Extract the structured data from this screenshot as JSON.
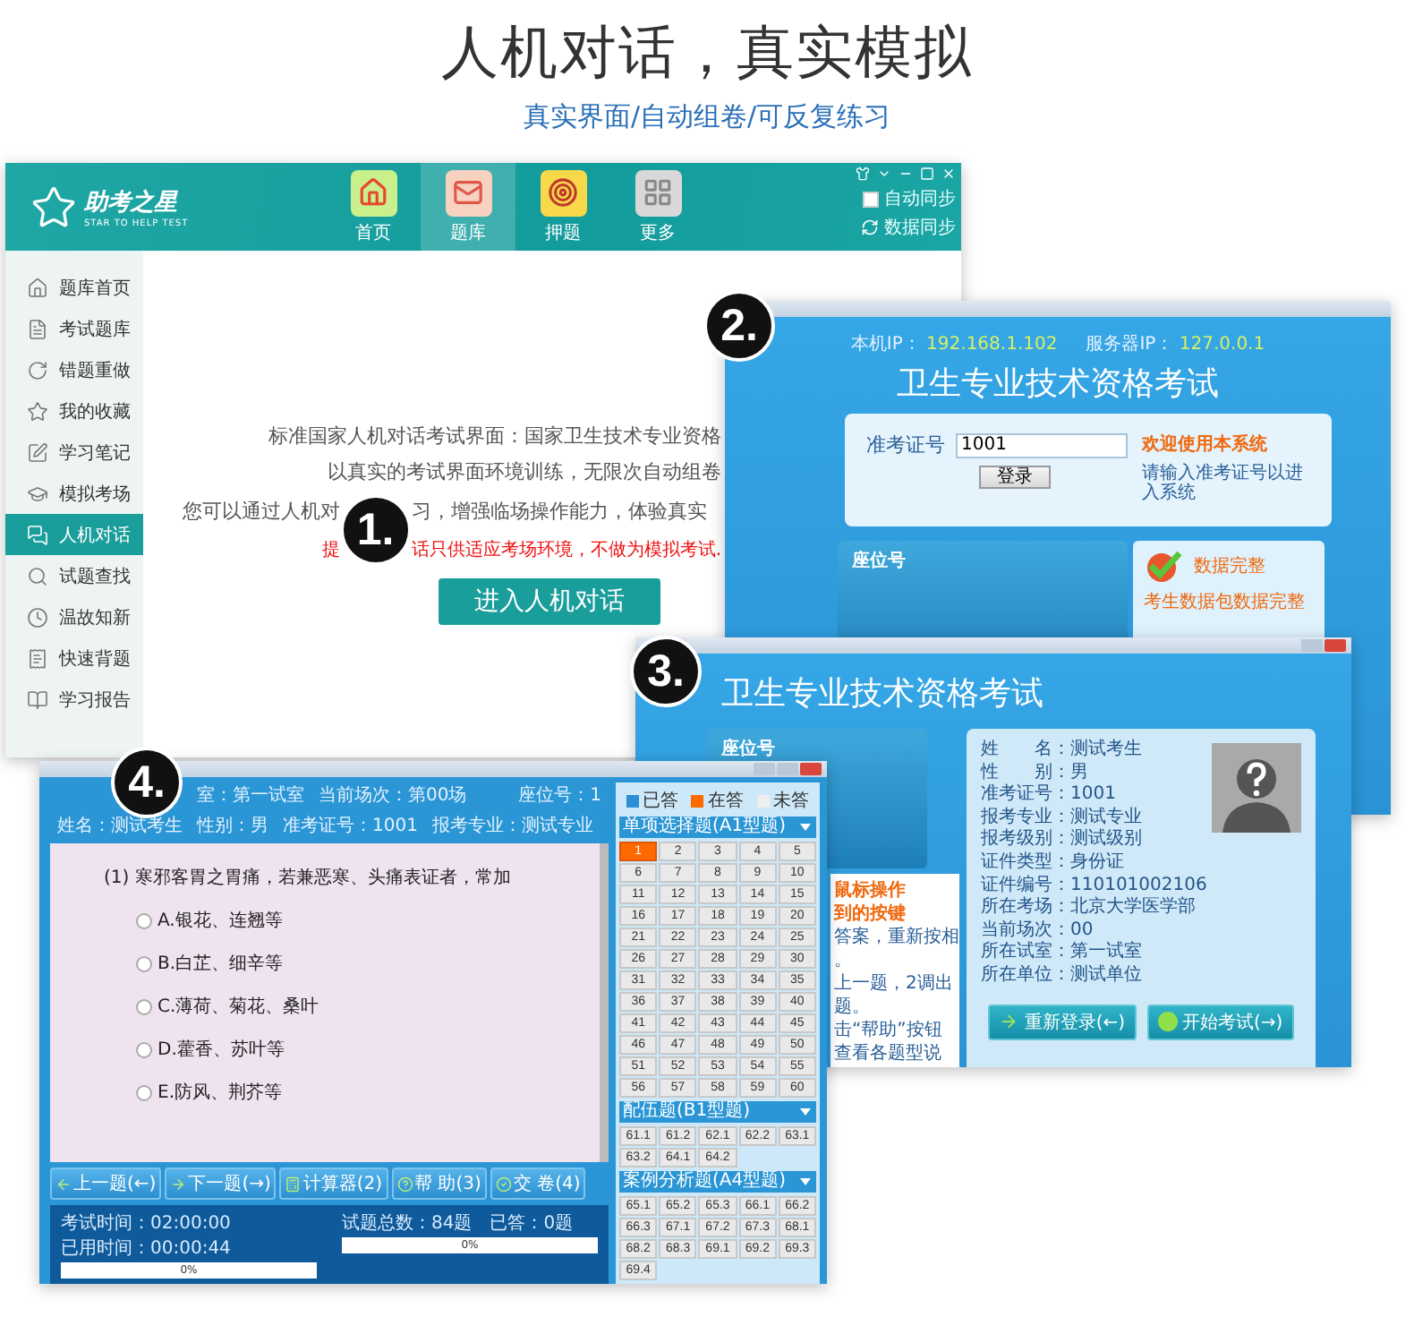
{
  "heading": {
    "title": "人机对话，真实模拟",
    "subtitle": "真实界面/自动组卷/可反复练习"
  },
  "badges": [
    "1.",
    "2.",
    "3.",
    "4."
  ],
  "main_window": {
    "logo": {
      "name": "助考之星",
      "tagline": "STAR TO HELP TEST"
    },
    "nav": [
      {
        "label": "首页",
        "selected": false
      },
      {
        "label": "题库",
        "selected": true
      },
      {
        "label": "押题",
        "selected": false
      },
      {
        "label": "更多",
        "selected": false
      }
    ],
    "auto_sync": {
      "label": "自动同步",
      "checked": false
    },
    "data_sync": {
      "label": "数据同步"
    },
    "sidebar": [
      {
        "label": "题库首页",
        "selected": false
      },
      {
        "label": "考试题库",
        "selected": false
      },
      {
        "label": "错题重做",
        "selected": false
      },
      {
        "label": "我的收藏",
        "selected": false
      },
      {
        "label": "学习笔记",
        "selected": false
      },
      {
        "label": "模拟考场",
        "selected": false
      },
      {
        "label": "人机对话",
        "selected": true
      },
      {
        "label": "试题查找",
        "selected": false
      },
      {
        "label": "温故知新",
        "selected": false
      },
      {
        "label": "快速背题",
        "selected": false
      },
      {
        "label": "学习报告",
        "selected": false
      }
    ],
    "intro_lines": [
      "标准国家人机对话考试界面：国家卫生技术专业资格",
      "以真实的考试界面环境训练，无限次自动组卷"
    ],
    "split_lines": [
      {
        "kind": "normal",
        "before": "您可以通过人机对",
        "after": "习，增强临场操作能力，体验真实"
      },
      {
        "kind": "notice",
        "before": "提",
        "after": "话只供适应考场环境，不做为模拟考试."
      }
    ],
    "enter_button": "进入人机对话"
  },
  "login_window": {
    "ip_label": "本机IP：",
    "ip": "192.168.1.102",
    "server_label": "服务器IP：",
    "server_ip": "127.0.0.1",
    "title": "卫生专业技术资格考试",
    "field_label": "准考证号",
    "field_value": "1001",
    "login_button": "登录",
    "welcome": "欢迎使用本系统",
    "hint": "请输入准考证号以进入系统",
    "seat_label": "座位号",
    "status_title": "数据完整",
    "status_text": "考生数据包数据完整"
  },
  "info_window": {
    "title": "卫生专业技术资格考试",
    "seat_label": "座位号",
    "notes": [
      {
        "text": "鼠标操作",
        "kind": "heading"
      },
      {
        "text": "到的按键",
        "kind": "heading"
      },
      {
        "text": "答案，重新按相",
        "kind": "plain"
      },
      {
        "text": "。",
        "kind": "plain"
      },
      {
        "text": "上一题，2调出",
        "kind": "plain"
      },
      {
        "text": "题。",
        "kind": "plain"
      },
      {
        "text": "击“帮助”按钮",
        "kind": "plain"
      },
      {
        "text": "查看各题型说",
        "kind": "plain"
      }
    ],
    "fields": [
      {
        "label": "姓　　名：",
        "value": "测试考生"
      },
      {
        "label": "性　　别：",
        "value": "男"
      },
      {
        "label": "准考证号：",
        "value": "1001"
      },
      {
        "label": "报考专业：",
        "value": "测试专业"
      },
      {
        "label": "报考级别：",
        "value": "测试级别"
      },
      {
        "label": "证件类型：",
        "value": "身份证"
      },
      {
        "label": "证件编号：",
        "value": "110101002106"
      },
      {
        "label": "所在考场：",
        "value": "北京大学医学部"
      },
      {
        "label": "当前场次：",
        "value": "00"
      },
      {
        "label": "所在试室：",
        "value": "第一试室"
      },
      {
        "label": "所在单位：",
        "value": "测试单位"
      }
    ],
    "buttons": [
      {
        "label": "重新登录(←)",
        "kind": "back"
      },
      {
        "label": "开始考试(→)",
        "kind": "start"
      }
    ]
  },
  "exam_window": {
    "info_top": [
      "室：第一试室",
      "当前场次：第00场",
      "座位号：1"
    ],
    "info_bottom": [
      "姓名：测试考生",
      "性别：男",
      "准考证号：1001",
      "报考专业：测试专业"
    ],
    "question": "(1) 寒邪客胃之胃痛，若兼恶寒、头痛表证者，常加",
    "options": [
      {
        "label": "A.银花、连翘等",
        "selected": false
      },
      {
        "label": "B.白芷、细辛等",
        "selected": false
      },
      {
        "label": "C.薄荷、菊花、桑叶",
        "selected": false
      },
      {
        "label": "D.藿香、苏叶等",
        "selected": false
      },
      {
        "label": "E.防风、荆芥等",
        "selected": false
      }
    ],
    "buttons": [
      {
        "label": "上一题(←)",
        "kind": "prev"
      },
      {
        "label": "下一题(→)",
        "kind": "next"
      },
      {
        "label": "计算器(2)",
        "kind": "calculator"
      },
      {
        "label": "帮 助(3)",
        "kind": "help"
      },
      {
        "label": "交 卷(4)",
        "kind": "submit"
      }
    ],
    "status": [
      {
        "texts": [
          "考试时间：02:00:00",
          "已用时间：00:00:44"
        ],
        "level": 0,
        "reading": "0%"
      },
      {
        "texts": [
          "试题总数：84题",
          "已答：0题"
        ],
        "level": 0,
        "reading": "0%"
      }
    ],
    "legend": [
      {
        "label": "已答",
        "color": "#2a8fd6"
      },
      {
        "label": "在答",
        "color": "#ff6a00"
      },
      {
        "label": "未答",
        "color": "#eeeeee"
      }
    ],
    "sections": [
      {
        "title": "单项选择题(A1型题)",
        "items": [
          {
            "label": "1",
            "selected": true
          },
          {
            "label": "2",
            "selected": false
          },
          {
            "label": "3",
            "selected": false
          },
          {
            "label": "4",
            "selected": false
          },
          {
            "label": "5",
            "selected": false
          },
          {
            "label": "6",
            "selected": false
          },
          {
            "label": "7",
            "selected": false
          },
          {
            "label": "8",
            "selected": false
          },
          {
            "label": "9",
            "selected": false
          },
          {
            "label": "10",
            "selected": false
          },
          {
            "label": "11",
            "selected": false
          },
          {
            "label": "12",
            "selected": false
          },
          {
            "label": "13",
            "selected": false
          },
          {
            "label": "14",
            "selected": false
          },
          {
            "label": "15",
            "selected": false
          },
          {
            "label": "16",
            "selected": false
          },
          {
            "label": "17",
            "selected": false
          },
          {
            "label": "18",
            "selected": false
          },
          {
            "label": "19",
            "selected": false
          },
          {
            "label": "20",
            "selected": false
          },
          {
            "label": "21",
            "selected": false
          },
          {
            "label": "22",
            "selected": false
          },
          {
            "label": "23",
            "selected": false
          },
          {
            "label": "24",
            "selected": false
          },
          {
            "label": "25",
            "selected": false
          },
          {
            "label": "26",
            "selected": false
          },
          {
            "label": "27",
            "selected": false
          },
          {
            "label": "28",
            "selected": false
          },
          {
            "label": "29",
            "selected": false
          },
          {
            "label": "30",
            "selected": false
          },
          {
            "label": "31",
            "selected": false
          },
          {
            "label": "32",
            "selected": false
          },
          {
            "label": "33",
            "selected": false
          },
          {
            "label": "34",
            "selected": false
          },
          {
            "label": "35",
            "selected": false
          },
          {
            "label": "36",
            "selected": false
          },
          {
            "label": "37",
            "selected": false
          },
          {
            "label": "38",
            "selected": false
          },
          {
            "label": "39",
            "selected": false
          },
          {
            "label": "40",
            "selected": false
          },
          {
            "label": "41",
            "selected": false
          },
          {
            "label": "42",
            "selected": false
          },
          {
            "label": "43",
            "selected": false
          },
          {
            "label": "44",
            "selected": false
          },
          {
            "label": "45",
            "selected": false
          },
          {
            "label": "46",
            "selected": false
          },
          {
            "label": "47",
            "selected": false
          },
          {
            "label": "48",
            "selected": false
          },
          {
            "label": "49",
            "selected": false
          },
          {
            "label": "50",
            "selected": false
          },
          {
            "label": "51",
            "selected": false
          },
          {
            "label": "52",
            "selected": false
          },
          {
            "label": "53",
            "selected": false
          },
          {
            "label": "54",
            "selected": false
          },
          {
            "label": "55",
            "selected": false
          },
          {
            "label": "56",
            "selected": false
          },
          {
            "label": "57",
            "selected": false
          },
          {
            "label": "58",
            "selected": false
          },
          {
            "label": "59",
            "selected": false
          },
          {
            "label": "60",
            "selected": false
          }
        ]
      },
      {
        "title": "配伍题(B1型题)",
        "items": [
          {
            "label": "61.1",
            "selected": false
          },
          {
            "label": "61.2",
            "selected": false
          },
          {
            "label": "62.1",
            "selected": false
          },
          {
            "label": "62.2",
            "selected": false
          },
          {
            "label": "63.1",
            "selected": false
          },
          {
            "label": "63.2",
            "selected": false
          },
          {
            "label": "64.1",
            "selected": false
          },
          {
            "label": "64.2",
            "selected": false
          }
        ]
      },
      {
        "title": "案例分析题(A4型题)",
        "items": [
          {
            "label": "65.1",
            "selected": false
          },
          {
            "label": "65.2",
            "selected": false
          },
          {
            "label": "65.3",
            "selected": false
          },
          {
            "label": "66.1",
            "selected": false
          },
          {
            "label": "66.2",
            "selected": false
          },
          {
            "label": "66.3",
            "selected": false
          },
          {
            "label": "67.1",
            "selected": false
          },
          {
            "label": "67.2",
            "selected": false
          },
          {
            "label": "67.3",
            "selected": false
          },
          {
            "label": "68.1",
            "selected": false
          },
          {
            "label": "68.2",
            "selected": false
          },
          {
            "label": "68.3",
            "selected": false
          },
          {
            "label": "69.1",
            "selected": false
          },
          {
            "label": "69.2",
            "selected": false
          },
          {
            "label": "69.3",
            "selected": false
          },
          {
            "label": "69.4",
            "selected": false
          }
        ]
      }
    ]
  }
}
